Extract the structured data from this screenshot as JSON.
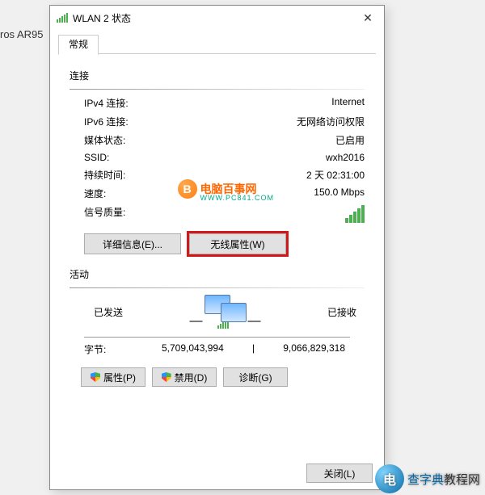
{
  "background_text": "ros AR95",
  "window": {
    "title": "WLAN 2 状态"
  },
  "tab": {
    "label": "常规"
  },
  "section_connection": "连接",
  "rows": {
    "ipv4_k": "IPv4 连接:",
    "ipv4_v": "Internet",
    "ipv6_k": "IPv6 连接:",
    "ipv6_v": "无网络访问权限",
    "media_k": "媒体状态:",
    "media_v": "已启用",
    "ssid_k": "SSID:",
    "ssid_v": "wxh2016",
    "dur_k": "持续时间:",
    "dur_v": "2 天 02:31:00",
    "speed_k": "速度:",
    "speed_v": "150.0 Mbps",
    "sig_k": "信号质量:"
  },
  "buttons": {
    "details": "详细信息(E)...",
    "wireless": "无线属性(W)",
    "props": "属性(P)",
    "disable": "禁用(D)",
    "diag": "诊断(G)",
    "close": "关闭(L)"
  },
  "section_activity": "活动",
  "activity": {
    "sent": "已发送",
    "recv": "已接收",
    "bytes_label": "字节:",
    "sent_val": "5,709,043,994",
    "recv_val": "9,066,829,318"
  },
  "watermark": {
    "main": "电脑百事网",
    "sub": "WWW.PC841.COM"
  },
  "bottom_wm": {
    "brand": "查字典",
    "suffix": "教程网"
  }
}
